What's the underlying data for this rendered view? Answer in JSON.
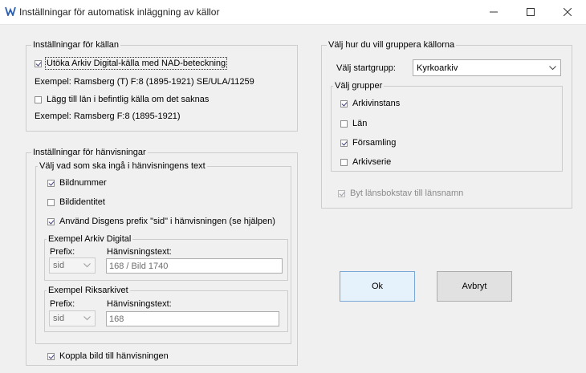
{
  "window": {
    "title": "Inställningar för automatisk inläggning av källor"
  },
  "source_settings": {
    "legend": "Inställningar för källan",
    "expand_ad": {
      "label": "Utöka Arkiv Digital-källa med NAD-beteckning",
      "checked": true
    },
    "example1": "Exempel: Ramsberg (T) F:8 (1895-1921) SE/ULA/11259",
    "add_county": {
      "label": "Lägg till län i befintlig källa om det saknas",
      "checked": false
    },
    "example2": "Exempel: Ramsberg F:8 (1895-1921)"
  },
  "grouping": {
    "legend": "Välj hur du vill gruppera källorna",
    "start_group_label": "Välj startgrupp:",
    "start_group_value": "Kyrkoarkiv",
    "choose_groups_legend": "Välj grupper",
    "groups": [
      {
        "label": "Arkivinstans",
        "checked": true
      },
      {
        "label": "Län",
        "checked": false
      },
      {
        "label": "Församling",
        "checked": true
      },
      {
        "label": "Arkivserie",
        "checked": false
      }
    ],
    "swap_county": {
      "label": "Byt länsbokstav till länsnamn",
      "checked": true,
      "disabled": true
    }
  },
  "references": {
    "legend": "Inställningar för hänvisningar",
    "choose_legend": "Välj vad som ska ingå i hänvisningens text",
    "image_number": {
      "label": "Bildnummer",
      "checked": true
    },
    "image_identity": {
      "label": "Bildidentitet",
      "checked": false
    },
    "use_prefix": {
      "label": "Använd Disgens prefix \"sid\" i hänvisningen (se hjälpen)",
      "checked": true
    },
    "example_ad": {
      "legend": "Exempel Arkiv Digital",
      "prefix_label": "Prefix:",
      "prefix_value": "sid",
      "text_label": "Hänvisningstext:",
      "text_value": "168 / Bild 1740"
    },
    "example_ra": {
      "legend": "Exempel Riksarkivet",
      "prefix_label": "Prefix:",
      "prefix_value": "sid",
      "text_label": "Hänvisningstext:",
      "text_value": "168"
    },
    "link_image": {
      "label": "Koppla bild till hänvisningen",
      "checked": true
    }
  },
  "buttons": {
    "ok": "Ok",
    "cancel": "Avbryt"
  }
}
